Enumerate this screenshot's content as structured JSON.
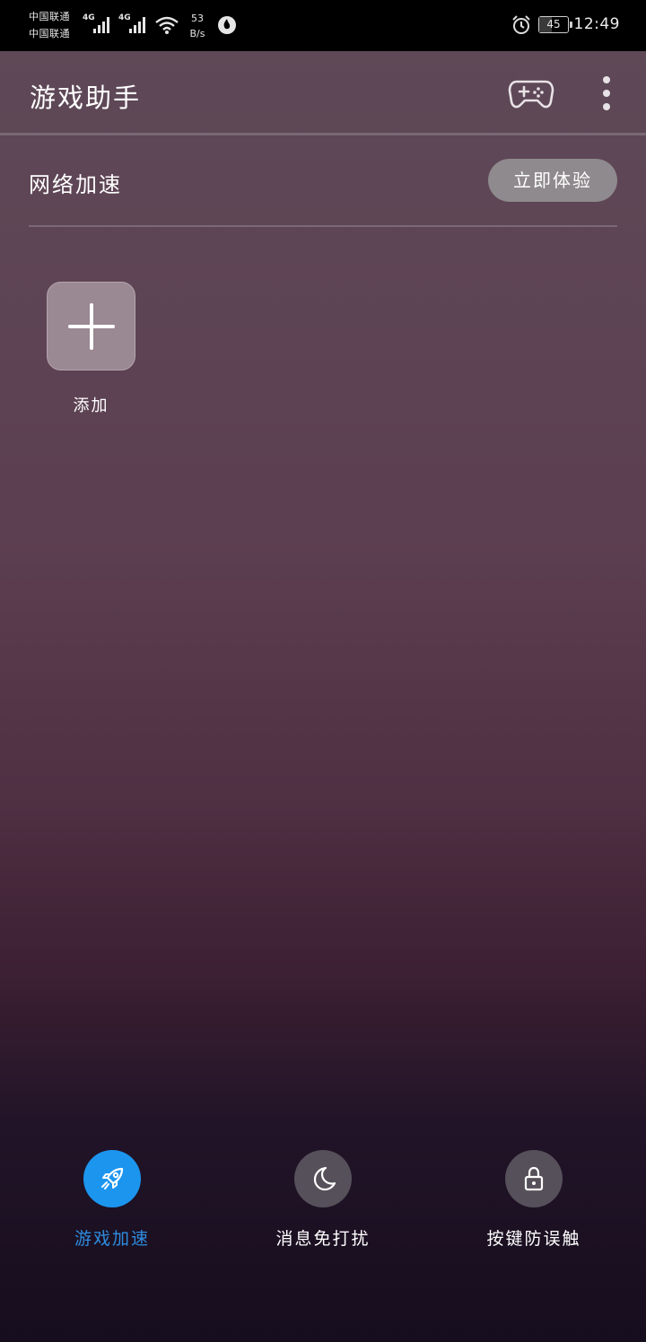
{
  "status_bar": {
    "carrier_1": "中国联通",
    "carrier_2": "中国联通",
    "network_1": "4G",
    "network_2": "4G",
    "speed_value": "53",
    "speed_unit": "B/s",
    "battery_level": "45",
    "time": "12:49",
    "icons": [
      "signal-icon",
      "wifi-icon",
      "flame-app-icon",
      "alarm-icon",
      "battery-icon"
    ]
  },
  "header": {
    "title": "游戏助手",
    "icons": [
      "gamepad-icon",
      "more-vertical-icon"
    ]
  },
  "network_boost": {
    "label": "网络加速",
    "button_label": "立即体验"
  },
  "games": {
    "add_label": "添加",
    "add_icon": "plus-icon"
  },
  "bottom_bar": {
    "items": [
      {
        "label": "游戏加速",
        "icon": "rocket-icon",
        "active": true
      },
      {
        "label": "消息免打扰",
        "icon": "moon-icon",
        "active": false
      },
      {
        "label": "按键防误触",
        "icon": "lock-icon",
        "active": false
      }
    ]
  },
  "colors": {
    "accent": "#1c95ef",
    "active_label": "#2d8de0",
    "button_bg": "#8f8a8d"
  }
}
